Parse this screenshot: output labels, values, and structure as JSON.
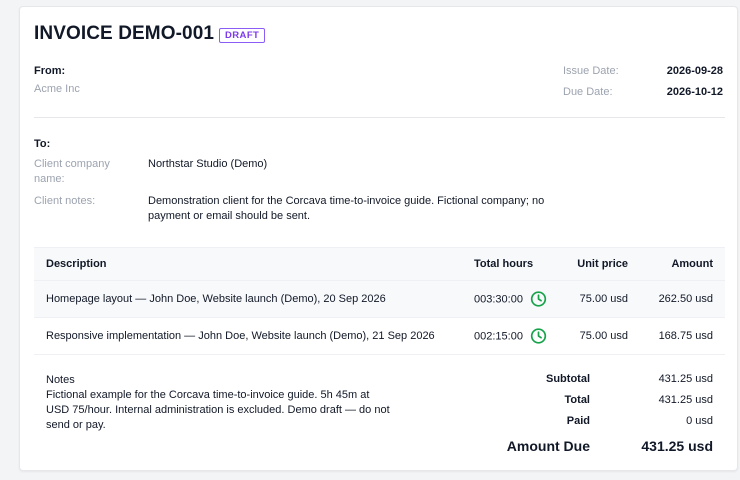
{
  "invoice": {
    "title": "INVOICE DEMO-001",
    "status_badge": "DRAFT"
  },
  "from": {
    "label": "From:",
    "company": "Acme Inc"
  },
  "dates": {
    "issue_label": "Issue Date:",
    "issue_value": "2026-09-28",
    "due_label": "Due Date:",
    "due_value": "2026-10-12"
  },
  "to": {
    "label": "To:",
    "company_label": "Client company name:",
    "company_value": "Northstar Studio (Demo)",
    "notes_label": "Client notes:",
    "notes_value": "Demonstration client for the Corcava time-to-invoice guide. Fictional company; no payment or email should be sent."
  },
  "table": {
    "headers": {
      "description": "Description",
      "hours": "Total hours",
      "price": "Unit price",
      "amount": "Amount"
    },
    "rows": [
      {
        "description": "Homepage layout — John Doe, Website launch (Demo), 20 Sep 2026",
        "hours": "003:30:00",
        "price": "75.00 usd",
        "amount": "262.50 usd"
      },
      {
        "description": "Responsive implementation — John Doe, Website launch (Demo), 21 Sep 2026",
        "hours": "002:15:00",
        "price": "75.00 usd",
        "amount": "168.75 usd"
      }
    ]
  },
  "notes": {
    "label": "Notes",
    "text": "Fictional example for the Corcava time-to-invoice guide. 5h 45m at USD 75/hour. Internal administration is excluded. Demo draft — do not send or pay."
  },
  "totals": {
    "subtotal_label": "Subtotal",
    "subtotal_value": "431.25 usd",
    "total_label": "Total",
    "total_value": "431.25 usd",
    "paid_label": "Paid",
    "paid_value": "0 usd",
    "due_label": "Amount Due",
    "due_value": "431.25 usd"
  },
  "icons": {
    "row_time": "clock-icon"
  },
  "colors": {
    "badge": "#7c3aed",
    "clock": "#16a34a",
    "muted": "#9ca3af"
  }
}
